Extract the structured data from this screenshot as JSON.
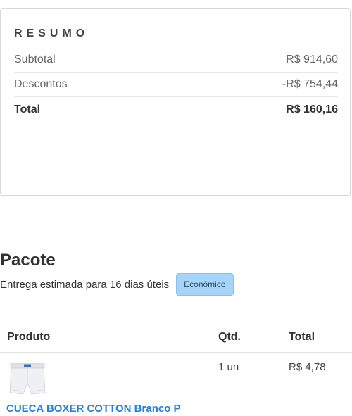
{
  "summary": {
    "title": "RESUMO",
    "subtotal_label": "Subtotal",
    "subtotal_value": "R$ 914,60",
    "discount_label": "Descontos",
    "discount_value": "-R$ 754,44",
    "total_label": "Total",
    "total_value": "R$ 160,16"
  },
  "package": {
    "title": "Pacote",
    "delivery_text": "Entrega estimada para 16 dias úteis",
    "shipping_badge": "Econômico"
  },
  "table": {
    "headers": {
      "product": "Produto",
      "qty": "Qtd.",
      "total": "Total"
    },
    "rows": [
      {
        "name": "CUECA BOXER COTTON Branco P",
        "qty": "1 un",
        "total": "R$ 4,78",
        "thumbnail_icon": "boxer-shorts-icon"
      }
    ]
  }
}
